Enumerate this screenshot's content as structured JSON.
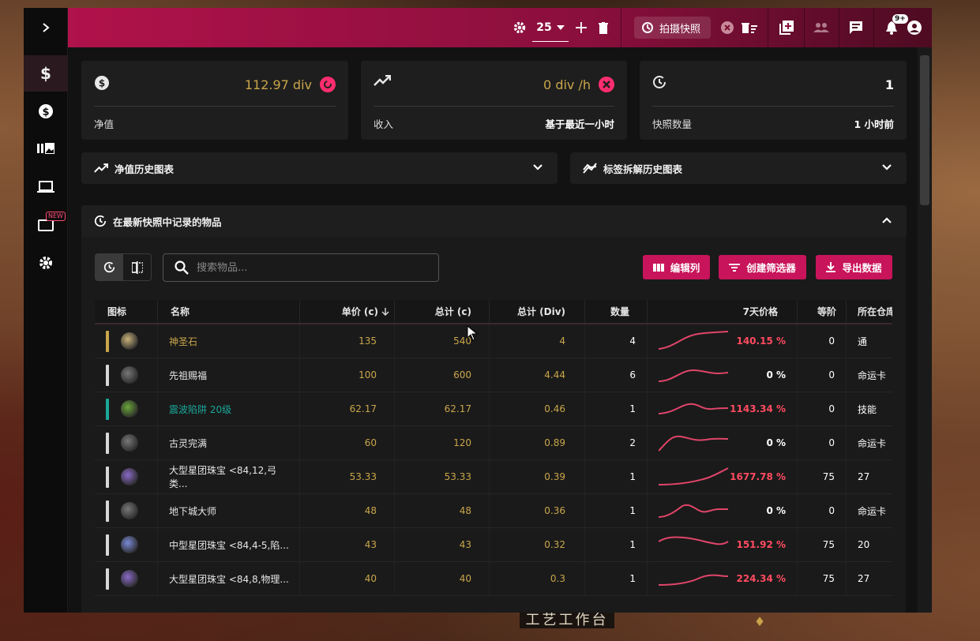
{
  "app": {
    "topbar": {
      "league_count": "25",
      "snapshot_label": "拍摄快照",
      "notif_count": "9+"
    },
    "sidebar": {
      "new_badge": "NEW",
      "items": [
        "expand",
        "currency",
        "price",
        "gallery",
        "laptop",
        "new-feature",
        "settings"
      ]
    },
    "cards": {
      "networth": {
        "value": "112.97 div",
        "label": "净值"
      },
      "income": {
        "value": "0 div /h",
        "label": "收入",
        "meta": "基于最近一小时"
      },
      "snapshots": {
        "value": "1",
        "label": "快照数量",
        "meta": "1 小时前"
      }
    },
    "accordions": {
      "networth_history": "净值历史图表",
      "tag_history": "标签拆解历史图表",
      "latest_items": "在最新快照中记录的物品"
    },
    "search": {
      "placeholder": "搜索物品..."
    },
    "actions": {
      "edit_columns": "编辑列",
      "create_filter": "创建筛选器",
      "export": "导出数据"
    },
    "columns": {
      "icon": "图标",
      "name": "名称",
      "unit_price": "单价 (c)",
      "total_c": "总计 (c)",
      "total_div": "总计 (Div)",
      "qty": "数量",
      "price7d": "7天价格",
      "level": "等阶",
      "tab": "所在仓库"
    },
    "rows": [
      {
        "name": "神圣石",
        "unit": "135",
        "total_c": "540",
        "total_div": "4",
        "qty": "4",
        "change": "140.15 %",
        "level": "0",
        "tab": "通",
        "rarity": "#c9a64a",
        "name_color": "#c9a64a",
        "icon_color": "#c9b27a",
        "change_color": "#ff4b60"
      },
      {
        "name": "先祖赐福",
        "unit": "100",
        "total_c": "600",
        "total_div": "4.44",
        "qty": "6",
        "change": "0 %",
        "level": "0",
        "tab": "命运卡",
        "rarity": "#d8d8d8",
        "name_color": "#e6e6e6",
        "icon_color": "#777",
        "change_color": "#ffffff"
      },
      {
        "name": "震波陷阱 20级",
        "unit": "62.17",
        "total_c": "62.17",
        "total_div": "0.46",
        "qty": "1",
        "change": "1143.34 %",
        "level": "0",
        "tab": "技能",
        "rarity": "#1aa89a",
        "name_color": "#1aa89a",
        "icon_color": "#6aa63a",
        "change_color": "#ff4b60"
      },
      {
        "name": "古灵完满",
        "unit": "60",
        "total_c": "120",
        "total_div": "0.89",
        "qty": "2",
        "change": "0 %",
        "level": "0",
        "tab": "命运卡",
        "rarity": "#d8d8d8",
        "name_color": "#e6e6e6",
        "icon_color": "#777",
        "change_color": "#ffffff"
      },
      {
        "name": "大型星团珠宝 <84,12,弓类...",
        "unit": "53.33",
        "total_c": "53.33",
        "total_div": "0.39",
        "qty": "1",
        "change": "1677.78 %",
        "level": "75",
        "tab": "27",
        "rarity": "#d8d8d8",
        "name_color": "#e6e6e6",
        "icon_color": "#8a6ac8",
        "change_color": "#ff4b60"
      },
      {
        "name": "地下城大师",
        "unit": "48",
        "total_c": "48",
        "total_div": "0.36",
        "qty": "1",
        "change": "0 %",
        "level": "0",
        "tab": "命运卡",
        "rarity": "#d8d8d8",
        "name_color": "#e6e6e6",
        "icon_color": "#777",
        "change_color": "#ffffff"
      },
      {
        "name": "中型星团珠宝 <84,4-5,陷...",
        "unit": "43",
        "total_c": "43",
        "total_div": "0.32",
        "qty": "1",
        "change": "151.92 %",
        "level": "75",
        "tab": "20",
        "rarity": "#d8d8d8",
        "name_color": "#e6e6e6",
        "icon_color": "#7a8ad8",
        "change_color": "#ff4b60"
      },
      {
        "name": "大型星团珠宝 <84,8,物理...",
        "unit": "40",
        "total_c": "40",
        "total_div": "0.3",
        "qty": "1",
        "change": "224.34 %",
        "level": "75",
        "tab": "27",
        "rarity": "#d8d8d8",
        "name_color": "#e6e6e6",
        "icon_color": "#8a6ac8",
        "change_color": "#ff4b60"
      }
    ],
    "game": {
      "caption": "工艺工作台"
    },
    "colors": {
      "accent": "#c8145a",
      "gold": "#c9a64a",
      "red": "#ff4b60"
    }
  }
}
